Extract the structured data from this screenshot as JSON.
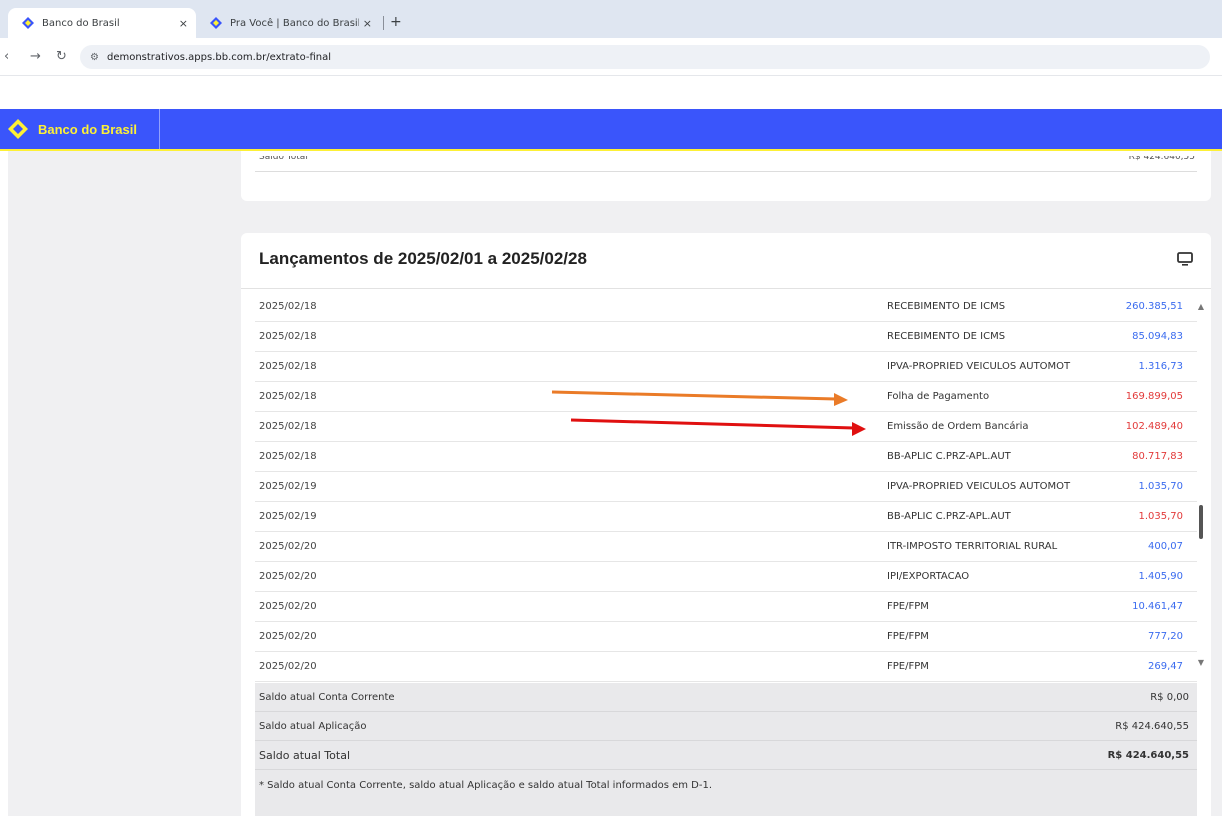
{
  "browser": {
    "tabs": [
      {
        "title": "Banco do Brasil",
        "close": "×"
      },
      {
        "title": "Pra Você | Banco do Brasil",
        "close": "×"
      }
    ],
    "new_tab": "+",
    "url": "demonstrativos.apps.bb.com.br/extrato-final"
  },
  "app": {
    "brand": "Banco do Brasil",
    "colors": {
      "header": "#3a55fb",
      "brand_yellow": "#fdf036",
      "credit": "#3a6bef",
      "debit": "#e23a3a"
    }
  },
  "statement": {
    "title": "Lançamentos de 2025/02/01 a 2025/02/28",
    "top_card_partial_label": "Saldo Total",
    "top_card_partial_value": "R$ 424.640,55",
    "rows": [
      {
        "date": "2025/02/18",
        "description": "RECEBIMENTO DE ICMS",
        "value": "260.385,51",
        "type": "credit"
      },
      {
        "date": "2025/02/18",
        "description": "RECEBIMENTO DE ICMS",
        "value": "85.094,83",
        "type": "credit"
      },
      {
        "date": "2025/02/18",
        "description": "IPVA-PROPRIED VEICULOS AUTOMOT",
        "value": "1.316,73",
        "type": "credit"
      },
      {
        "date": "2025/02/18",
        "description": "Folha de Pagamento",
        "value": "169.899,05",
        "type": "debit"
      },
      {
        "date": "2025/02/18",
        "description": "Emissão de Ordem Bancária",
        "value": "102.489,40",
        "type": "debit"
      },
      {
        "date": "2025/02/18",
        "description": "BB-APLIC C.PRZ-APL.AUT",
        "value": "80.717,83",
        "type": "debit"
      },
      {
        "date": "2025/02/19",
        "description": "IPVA-PROPRIED VEICULOS AUTOMOT",
        "value": "1.035,70",
        "type": "credit"
      },
      {
        "date": "2025/02/19",
        "description": "BB-APLIC C.PRZ-APL.AUT",
        "value": "1.035,70",
        "type": "debit"
      },
      {
        "date": "2025/02/20",
        "description": "ITR-IMPOSTO TERRITORIAL RURAL",
        "value": "400,07",
        "type": "credit"
      },
      {
        "date": "2025/02/20",
        "description": "IPI/EXPORTACAO",
        "value": "1.405,90",
        "type": "credit"
      },
      {
        "date": "2025/02/20",
        "description": "FPE/FPM",
        "value": "10.461,47",
        "type": "credit"
      },
      {
        "date": "2025/02/20",
        "description": "FPE/FPM",
        "value": "777,20",
        "type": "credit"
      },
      {
        "date": "2025/02/20",
        "description": "FPE/FPM",
        "value": "269,47",
        "type": "credit"
      }
    ],
    "summary": {
      "conta_corrente_label": "Saldo atual Conta Corrente",
      "conta_corrente_value": "R$ 0,00",
      "aplicacao_label": "Saldo atual Aplicação",
      "aplicacao_value": "R$ 424.640,55",
      "total_label": "Saldo atual Total",
      "total_value": "R$ 424.640,55",
      "footnote": "* Saldo atual Conta Corrente, saldo atual Aplicação e saldo atual Total informados em D-1."
    }
  },
  "annotations": {
    "arrow_colors": [
      "#ea7b28",
      "#e01010"
    ]
  }
}
